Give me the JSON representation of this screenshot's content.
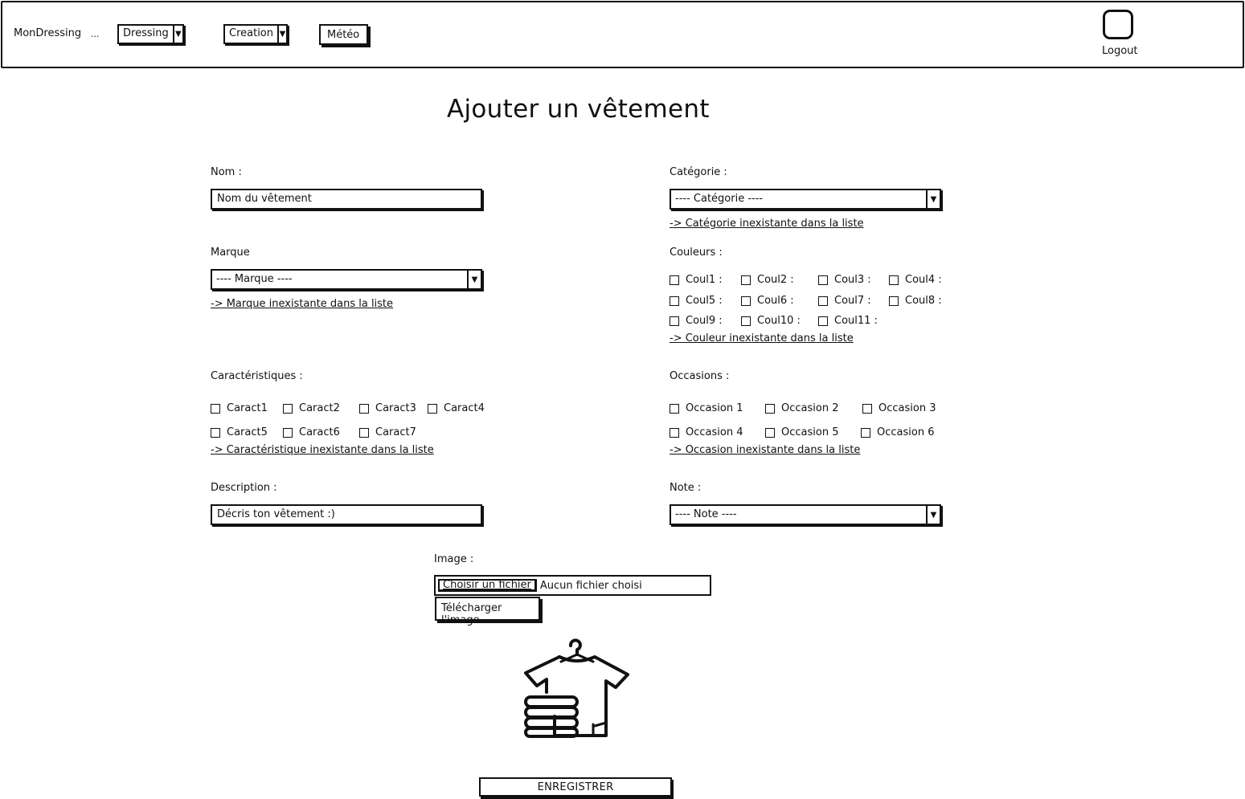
{
  "header": {
    "brand": "MonDressing",
    "dots": "...",
    "nav": {
      "dressing": "Dressing",
      "creation": "Creation",
      "meteo": "Météo"
    },
    "logout": "Logout"
  },
  "page_title": "Ajouter un vêtement",
  "form": {
    "nom": {
      "label": "Nom :",
      "value": "Nom du vêtement"
    },
    "categorie": {
      "label": "Catégorie :",
      "selected": "---- Catégorie ----",
      "missing_link": "-> Catégorie inexistante dans la liste"
    },
    "marque": {
      "label": "Marque",
      "selected": "---- Marque ----",
      "missing_link": "-> Marque inexistante dans la liste"
    },
    "couleurs": {
      "label": "Couleurs :",
      "options": [
        "Coul1 :",
        "Coul2 :",
        "Coul3 :",
        "Coul4 :",
        "Coul5 :",
        "Coul6 :",
        "Coul7 :",
        "Coul8 :",
        "Coul9 :",
        "Coul10 :",
        "Coul11 :"
      ],
      "missing_link": "-> Couleur inexistante dans la liste"
    },
    "caracteristiques": {
      "label": "Caractéristiques :",
      "options": [
        "Caract1",
        "Caract2",
        "Caract3",
        "Caract4",
        "Caract5",
        "Caract6",
        "Caract7"
      ],
      "missing_link": "-> Caractéristique inexistante dans la liste"
    },
    "occasions": {
      "label": "Occasions :",
      "options": [
        "Occasion 1",
        "Occasion 2",
        "Occasion 3",
        "Occasion 4",
        "Occasion 5",
        "Occasion 6"
      ],
      "missing_link": "-> Occasion inexistante dans la liste"
    },
    "description": {
      "label": "Description :",
      "value": "Décris ton vêtement :)"
    },
    "note": {
      "label": "Note :",
      "selected": "---- Note ----"
    },
    "image": {
      "label": "Image :",
      "choose_button": "Choisir un fichier",
      "no_file": "Aucun fichier choisi",
      "upload_button": "Télécharger l'image",
      "preview_icon": "clothes-hanger-icon"
    },
    "submit": "ENREGISTRER"
  }
}
